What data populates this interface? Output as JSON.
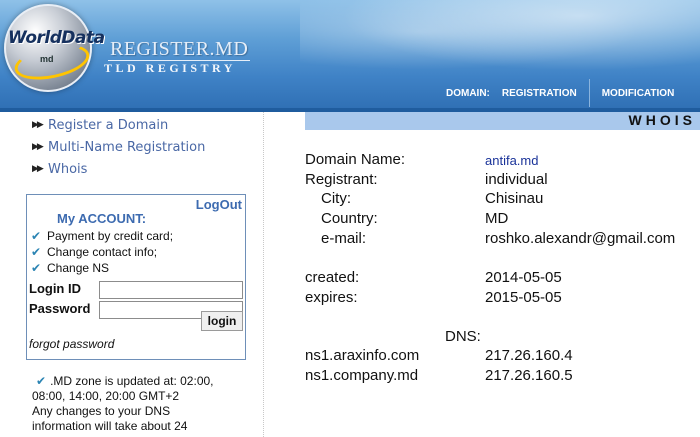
{
  "header": {
    "logo_text": "WorldData",
    "logo_sub": "md",
    "site_title": "REGISTER.MD",
    "site_subtitle": "TLD REGISTRY",
    "nav": [
      {
        "label": "DOMAIN:"
      },
      {
        "label": "REGISTRATION"
      },
      {
        "label": "MODIFICATION"
      }
    ]
  },
  "sidebar": {
    "menu": [
      {
        "label": "Register a Domain"
      },
      {
        "label": "Multi-Name Registration"
      },
      {
        "label": "Whois"
      }
    ]
  },
  "account": {
    "logout": "LogOut",
    "title": "My ACCOUNT:",
    "features": [
      "Payment by credit card;",
      "Change contact info;",
      "Change NS"
    ],
    "login_id_label": "Login ID",
    "password_label": "Password",
    "login_id_value": "",
    "password_value": "",
    "login_button": "login",
    "forgot_password": "forgot password"
  },
  "notice": {
    "line1": ".MD zone is updated at: 02:00,",
    "line2": "08:00, 14:00, 20:00 GMT+2",
    "line3": "Any changes to your DNS",
    "line4": "information will take about 24"
  },
  "whois": {
    "title": "WHOIS",
    "domain_label": "Domain Name:",
    "domain_value": "antifa.md",
    "registrant_label": "Registrant:",
    "registrant_value": "individual",
    "city_label": "City:",
    "city_value": "Chisinau",
    "country_label": "Country:",
    "country_value": "MD",
    "email_label": "e-mail:",
    "email_value": "roshko.alexandr@gmail.com",
    "created_label": "created:",
    "created_value": "2014-05-05",
    "expires_label": "expires:",
    "expires_value": "2015-05-05",
    "dns_label": "DNS:",
    "dns": [
      {
        "host": "ns1.araxinfo.com",
        "ip": "217.26.160.4"
      },
      {
        "host": "ns1.company.md",
        "ip": "217.26.160.5"
      }
    ]
  }
}
